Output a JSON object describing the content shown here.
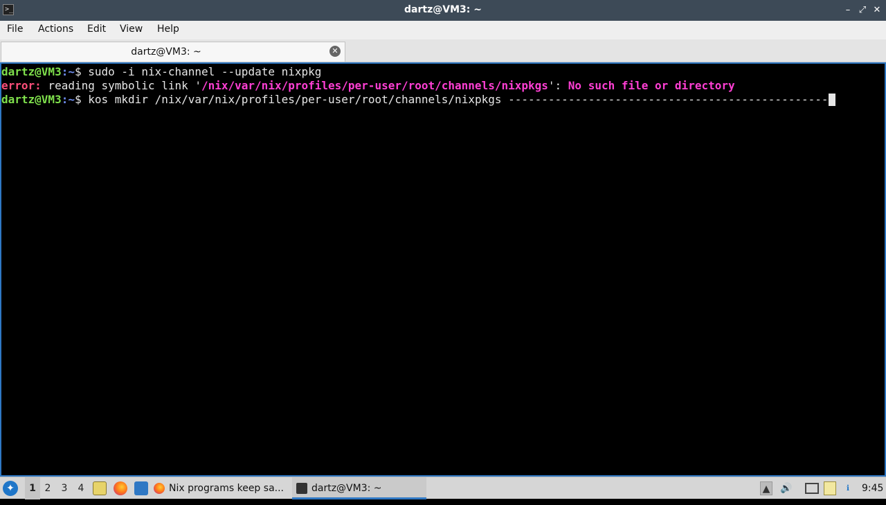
{
  "window": {
    "title": "dartz@VM3: ~",
    "app_icon": "terminal-icon",
    "controls": {
      "minimize": "–",
      "maximize": "⤢",
      "close": "✕"
    }
  },
  "menu": {
    "items": [
      "File",
      "Actions",
      "Edit",
      "View",
      "Help"
    ]
  },
  "tabs": [
    {
      "label": "dartz@VM3: ~",
      "close_icon": "close-circle-icon"
    }
  ],
  "terminal": {
    "lines": [
      {
        "user_host": "dartz@VM3",
        "path_sep": ":",
        "path": "~",
        "prompt_end": "$ ",
        "command": "sudo -i nix-channel --update nixpkg"
      },
      {
        "error_label": "error:",
        "text1": " reading symbolic link '",
        "path": "/nix/var/nix/profiles/per-user/root/channels/nixpkgs",
        "text2": "': ",
        "message": "No such file or directory"
      },
      {
        "user_host": "dartz@VM3",
        "path_sep": ":",
        "path": "~",
        "prompt_end": "$ ",
        "command": "kos mkdir /nix/var/nix/profiles/per-user/root/channels/nixpkgs ------------------------------------------------"
      }
    ],
    "colors": {
      "prompt_user": "#7fe04c",
      "prompt_path": "#6f8ef0",
      "error": "#ff4f7a",
      "highlight": "#ff3fd4"
    }
  },
  "taskbar": {
    "start_icon": "lxqt-start-icon",
    "desktops": [
      "1",
      "2",
      "3",
      "4"
    ],
    "active_desktop": "1",
    "quicklaunch": [
      "file-manager-icon",
      "firefox-icon",
      "show-desktop-icon"
    ],
    "windows": [
      {
        "label": "Nix programs keep sa...",
        "icon": "firefox-icon",
        "active": false
      },
      {
        "label": "dartz@VM3: ~",
        "icon": "terminal-icon",
        "active": true
      }
    ],
    "tray": [
      "removable-media-icon",
      "volume-icon",
      "network-icon",
      "clipboard-icon",
      "notification-icon"
    ],
    "clock": "9:45"
  }
}
